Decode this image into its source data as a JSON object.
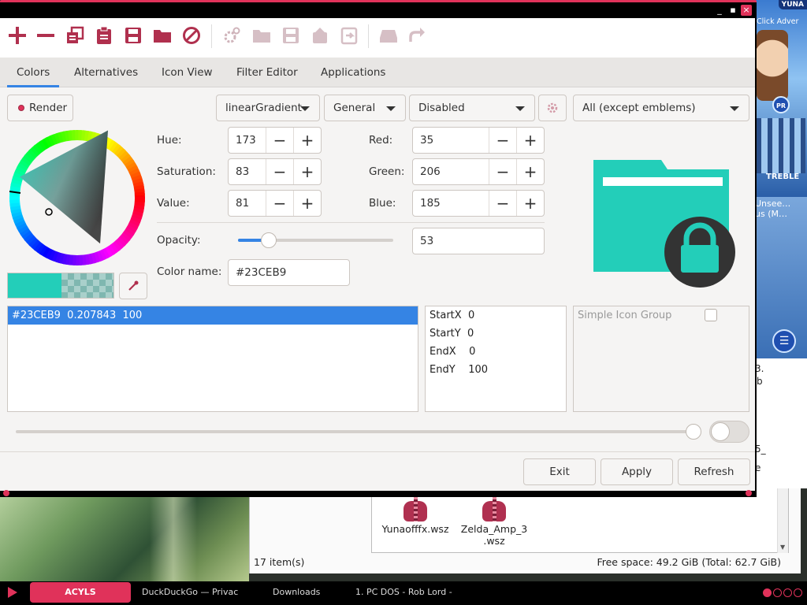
{
  "tabs": [
    "Colors",
    "Alternatives",
    "Icon View",
    "Filter Editor",
    "Applications"
  ],
  "render_label": "Render",
  "dropdowns": {
    "gradient": "linearGradient",
    "category": "General",
    "mode": "Disabled",
    "filter": "All (except emblems)"
  },
  "hsv": {
    "hue_label": "Hue:",
    "hue": "173",
    "sat_label": "Saturation:",
    "sat": "83",
    "val_label": "Value:",
    "val": "81"
  },
  "rgb": {
    "red_label": "Red:",
    "red": "35",
    "green_label": "Green:",
    "green": "206",
    "blue_label": "Blue:",
    "blue": "185"
  },
  "opacity": {
    "label": "Opacity:",
    "value": "53",
    "slider_fraction": 0.2
  },
  "color_name": {
    "label": "Color name:",
    "value": "#23CEB9"
  },
  "stop_row": "#23CEB9  0.207843  100",
  "gradient_props": [
    {
      "key": "StartX",
      "value": "0"
    },
    {
      "key": "StartY",
      "value": "0"
    },
    {
      "key": "EndX",
      "value": "0"
    },
    {
      "key": "EndY",
      "value": "100"
    }
  ],
  "simple_icon_group": "Simple Icon Group",
  "buttons": {
    "exit": "Exit",
    "apply": "Apply",
    "refresh": "Refresh"
  },
  "preview_color": "#23CEB9",
  "file_manager": {
    "files": [
      "Yunaofffx.wsz",
      "Zelda_Amp_3\n.wsz"
    ],
    "item_count": "17 item(s)",
    "free_space": "Free space: 49.2 GiB (Total: 62.7 GiB)"
  },
  "right_strip": {
    "ad_yuna": "YUNA",
    "ad_click": "Click Adver",
    "ad_pr": "PR",
    "ad_treble": "TREBLE",
    "player_line1": "Unsee…",
    "player_line2": "us (M…",
    "fragment1": "3.",
    "fragment2": "b",
    "fragment3": "5_",
    "fragment4": "e"
  },
  "taskbar": {
    "active": "ACYLS",
    "items": [
      "DuckDuckGo — Privac",
      "Downloads",
      "1. PC DOS - Rob Lord -"
    ]
  },
  "colors": {
    "accent": "#3584e4",
    "brand": "#e0325a",
    "icon_fg": "#b0304e"
  }
}
